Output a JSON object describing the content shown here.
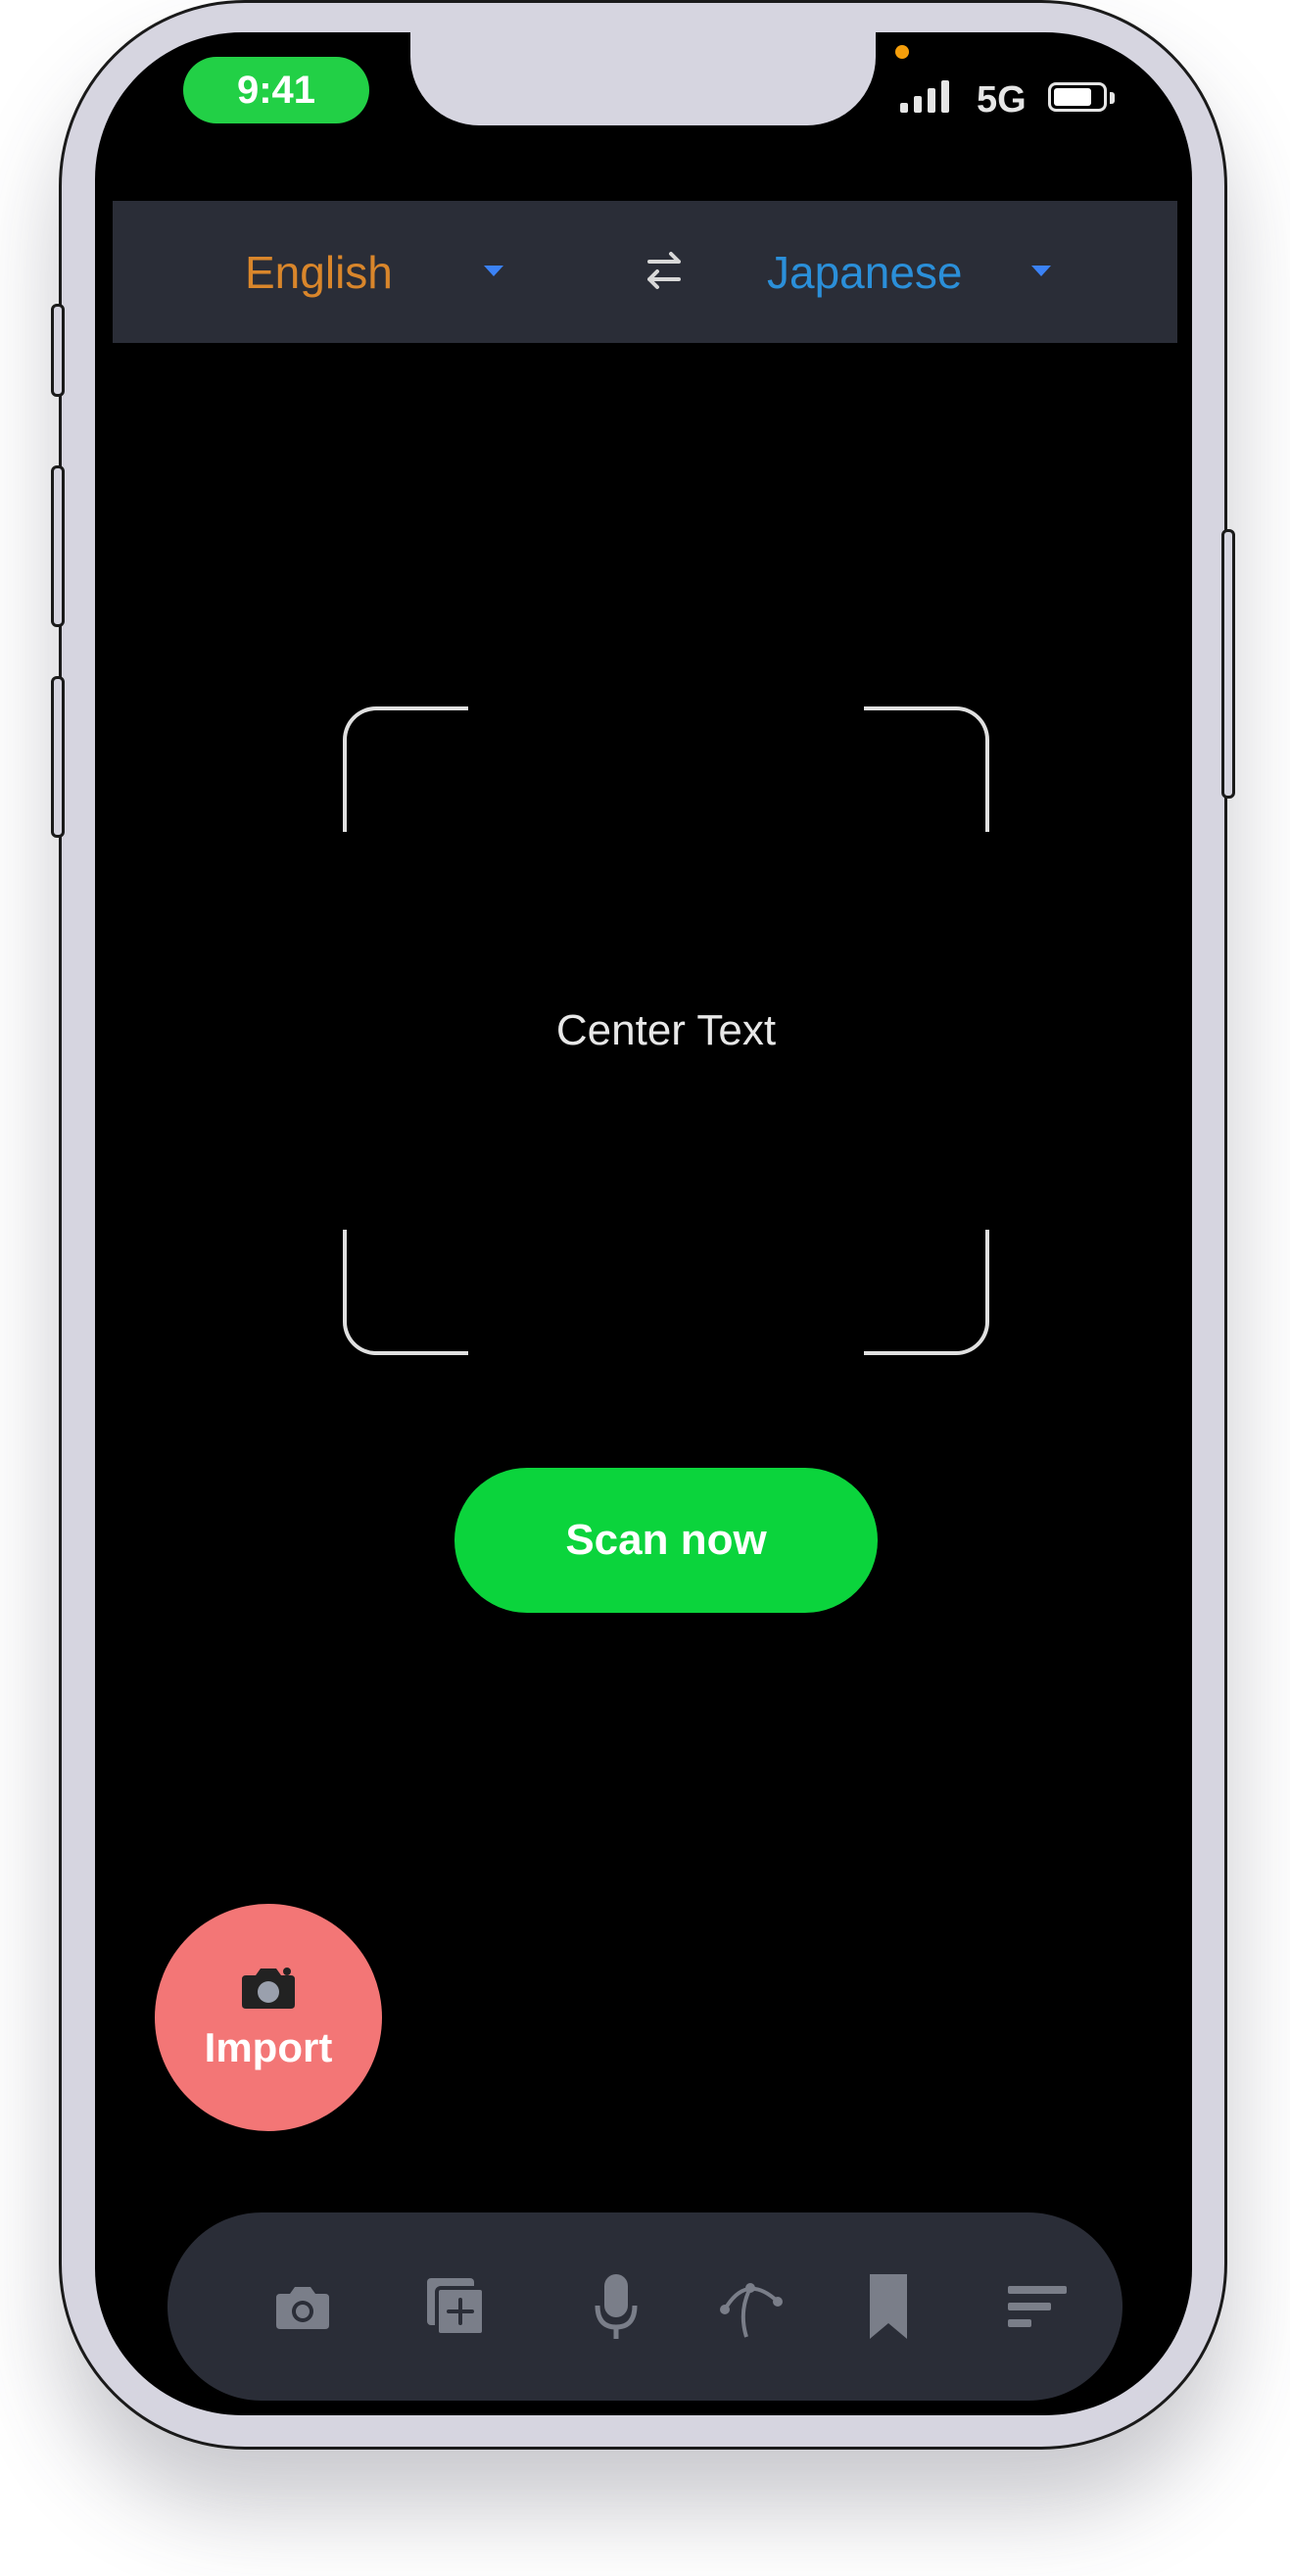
{
  "status_bar": {
    "time": "9:41",
    "network": "5G",
    "battery_level": 0.8
  },
  "language_bar": {
    "source_language": "English",
    "target_language": "Japanese",
    "swap_icon": "swap-arrows-icon"
  },
  "scanner": {
    "center_text": "Center Text",
    "scan_button_label": "Scan now"
  },
  "import_button": {
    "label": "Import",
    "icon": "camera-icon"
  },
  "bottom_nav": {
    "items": [
      {
        "icon": "camera-icon"
      },
      {
        "icon": "add-document-icon"
      },
      {
        "icon": "microphone-icon"
      },
      {
        "icon": "curve-pen-icon"
      },
      {
        "icon": "bookmark-icon"
      },
      {
        "icon": "list-icon"
      }
    ]
  },
  "colors": {
    "source_language": "#d9862b",
    "target_language": "#2b8fd9",
    "scan_button": "#0bd43c",
    "import_button": "#f37676",
    "time_pill": "#22d046",
    "bar_background": "#2a2d37"
  }
}
